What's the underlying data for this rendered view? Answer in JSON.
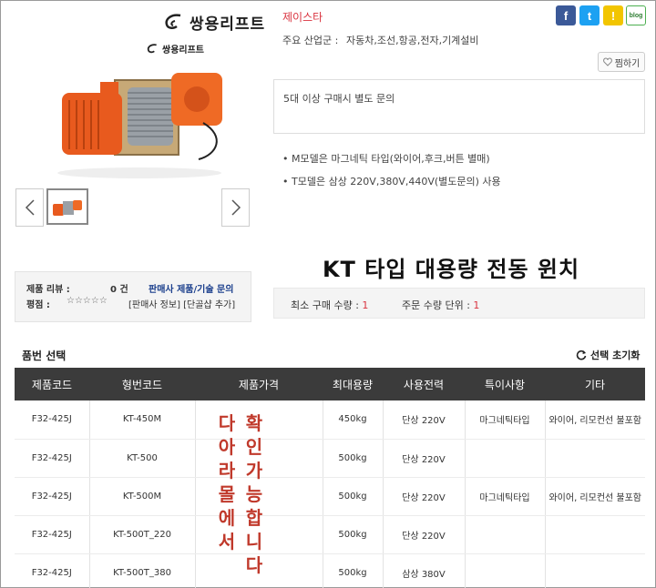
{
  "brand": {
    "name": "쌍용리프트",
    "sub_name": "쌍용리프트"
  },
  "gallery": {
    "prev": "‹",
    "next": "›"
  },
  "seller": {
    "name": "제이스타"
  },
  "industry": {
    "label": "주요 산업군 :",
    "value": "자동차,조선,항공,전자,기계설비"
  },
  "share": {
    "facebook": "f",
    "twitter": "t",
    "kakao": "!",
    "blog": "blog"
  },
  "bookmark": {
    "label": "찜하기"
  },
  "notice": {
    "text": "5대 이상 구매시 별도 문의"
  },
  "bullets": [
    "M모델은 마그네틱 타입(와이어,후크,버튼 별매)",
    "T모델은 삼상 220V,380V,440V(별도문의) 사용"
  ],
  "product_title": "KT 타입 대용량 전동 윈치",
  "review": {
    "label": "제품 리뷰 :",
    "count": "0 건",
    "inquiry": "판매사 제품/기술 문의",
    "rating_label": "평점 :",
    "stars": "☆☆☆☆☆",
    "links": "[판매사 정보] [단골샵 추가]"
  },
  "order": {
    "min_label": "최소 구매 수량 : ",
    "min_value": "1",
    "unit_label": "주문 수량 단위 : ",
    "unit_value": "1"
  },
  "selection": {
    "title": "품번 선택",
    "reset": "선택 초기화"
  },
  "table": {
    "headers": [
      "제품코드",
      "형번코드",
      "제품가격",
      "최대용량",
      "사용전력",
      "특이사항",
      "기타"
    ],
    "rows": [
      [
        "F32-425J",
        "KT-450M",
        "",
        "450kg",
        "단상 220V",
        "마그네틱타입",
        "와이어, 리모컨선 불포함"
      ],
      [
        "F32-425J",
        "KT-500",
        "",
        "500kg",
        "단상 220V",
        "",
        ""
      ],
      [
        "F32-425J",
        "KT-500M",
        "",
        "500kg",
        "단상 220V",
        "마그네틱타입",
        "와이어, 리모컨선 불포함"
      ],
      [
        "F32-425J",
        "KT-500T_220",
        "",
        "500kg",
        "단상 220V",
        "",
        ""
      ],
      [
        "F32-425J",
        "KT-500T_380",
        "",
        "500kg",
        "삼상 380V",
        "",
        ""
      ]
    ]
  },
  "overlay": {
    "left": [
      "다",
      "아",
      "라",
      "몰",
      "에",
      "서"
    ],
    "right": [
      "확",
      "인",
      "가",
      "능",
      "합",
      "니",
      "다"
    ]
  },
  "colors": {
    "accent_red": "#d9333f",
    "header_dark": "#3b3b3b",
    "overlay_red": "#c0392b",
    "winch_orange": "#e85a1e"
  }
}
